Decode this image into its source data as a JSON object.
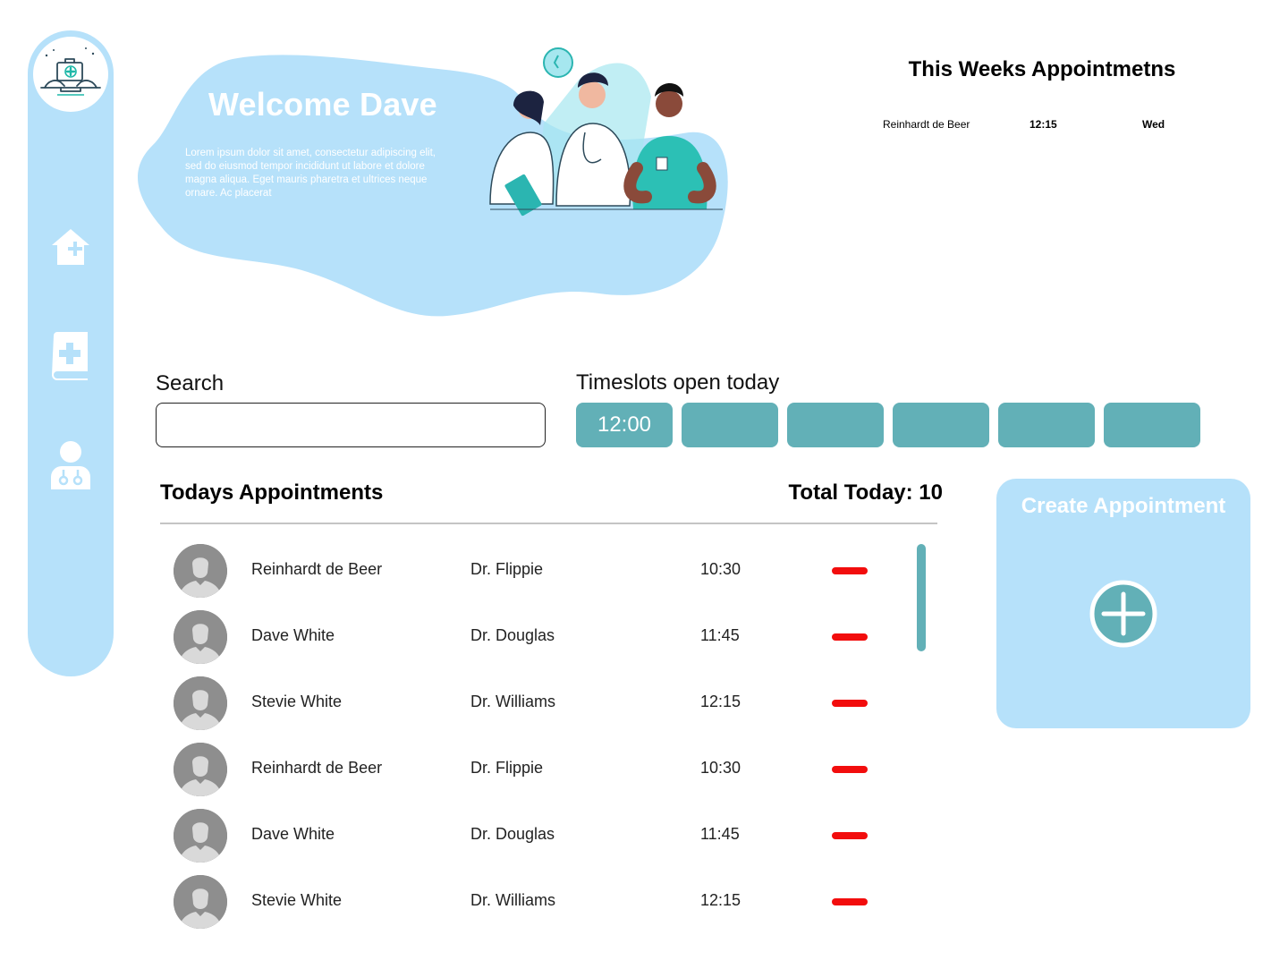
{
  "sidebar": {
    "logo_icon": "clinic-logo-icon",
    "items": [
      {
        "icon": "home-icon"
      },
      {
        "icon": "medical-book-icon"
      },
      {
        "icon": "doctor-icon"
      }
    ]
  },
  "hero": {
    "title": "Welcome Dave",
    "text": "Lorem ipsum dolor sit amet, consectetur adipiscing elit, sed do eiusmod tempor incididunt ut labore et dolore magna aliqua. Eget mauris pharetra et ultrices neque ornare. Ac placerat",
    "illustration": "doctors-illustration"
  },
  "week": {
    "title": "This Weeks Appointmetns",
    "rows": [
      {
        "name": "Reinhardt de Beer",
        "time": "12:15",
        "day": "Wed"
      }
    ]
  },
  "search": {
    "label": "Search",
    "value": "",
    "placeholder": ""
  },
  "timeslots": {
    "label": "Timeslots open today",
    "slots": [
      "12:00",
      "",
      "",
      "",
      "",
      ""
    ]
  },
  "today": {
    "title": "Todays Appointments",
    "total_label": "Total Today: 10",
    "rows": [
      {
        "name": "Reinhardt de Beer",
        "doctor": "Dr. Flippie",
        "time": "10:30"
      },
      {
        "name": "Dave White",
        "doctor": "Dr. Douglas",
        "time": "11:45"
      },
      {
        "name": "Stevie White",
        "doctor": "Dr. Williams",
        "time": "12:15"
      },
      {
        "name": "Reinhardt de Beer",
        "doctor": "Dr. Flippie",
        "time": "10:30"
      },
      {
        "name": "Dave White",
        "doctor": "Dr. Douglas",
        "time": "11:45"
      },
      {
        "name": "Stevie White",
        "doctor": "Dr. Williams",
        "time": "12:15"
      }
    ]
  },
  "create": {
    "title": "Create Appointment",
    "icon": "plus-circle-icon"
  },
  "colors": {
    "light_blue": "#b6e1fa",
    "teal": "#62b0b7",
    "remove_red": "#f20d0d",
    "avatar_gray": "#8e8e8e"
  }
}
